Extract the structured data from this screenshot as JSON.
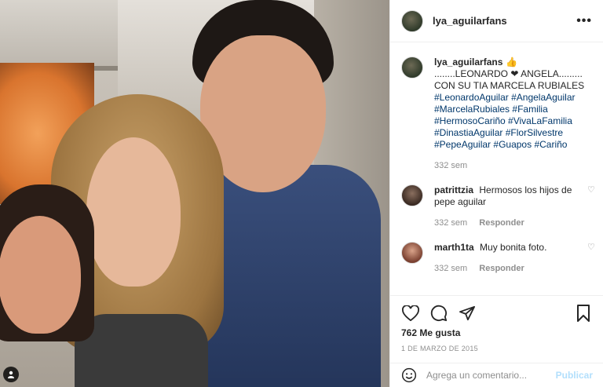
{
  "post": {
    "username": "lya_aguilarfans",
    "more_icon": "more-horizontal-icon",
    "caption_username": "lya_aguilarfans",
    "caption_emoji": "👍",
    "caption_line1": "........LEONARDO ❤ ANGELA.........",
    "caption_line2": "CON SU TIA MARCELA RUBIALES",
    "hashtags": [
      "#LeonardoAguilar",
      "#AngelaAguilar",
      "#MarcelaRubiales",
      "#Familia",
      "#HermosoCariño",
      "#VivaLaFamilia",
      "#DinastiaAguilar",
      "#FlorSilvestre",
      "#PepeAguilar",
      "#Guapos",
      "#Cariño"
    ],
    "caption_time": "332 sem"
  },
  "comments": [
    {
      "username": "patrittzia",
      "text": "Hermosos los hijos de pepe aguilar",
      "time": "332 sem",
      "reply": "Responder"
    },
    {
      "username": "marth1ta",
      "text": "Muy bonita foto.",
      "time": "332 sem",
      "reply": "Responder"
    }
  ],
  "actions": {
    "likes": "762 Me gusta",
    "date": "1 DE MARZO DE 2015"
  },
  "add_comment": {
    "placeholder": "Agrega un comentario...",
    "post_label": "Publicar"
  },
  "colors": {
    "hashtag": "#00376b",
    "meta": "#8e8e8e",
    "post_disabled": "#b2dffc"
  }
}
